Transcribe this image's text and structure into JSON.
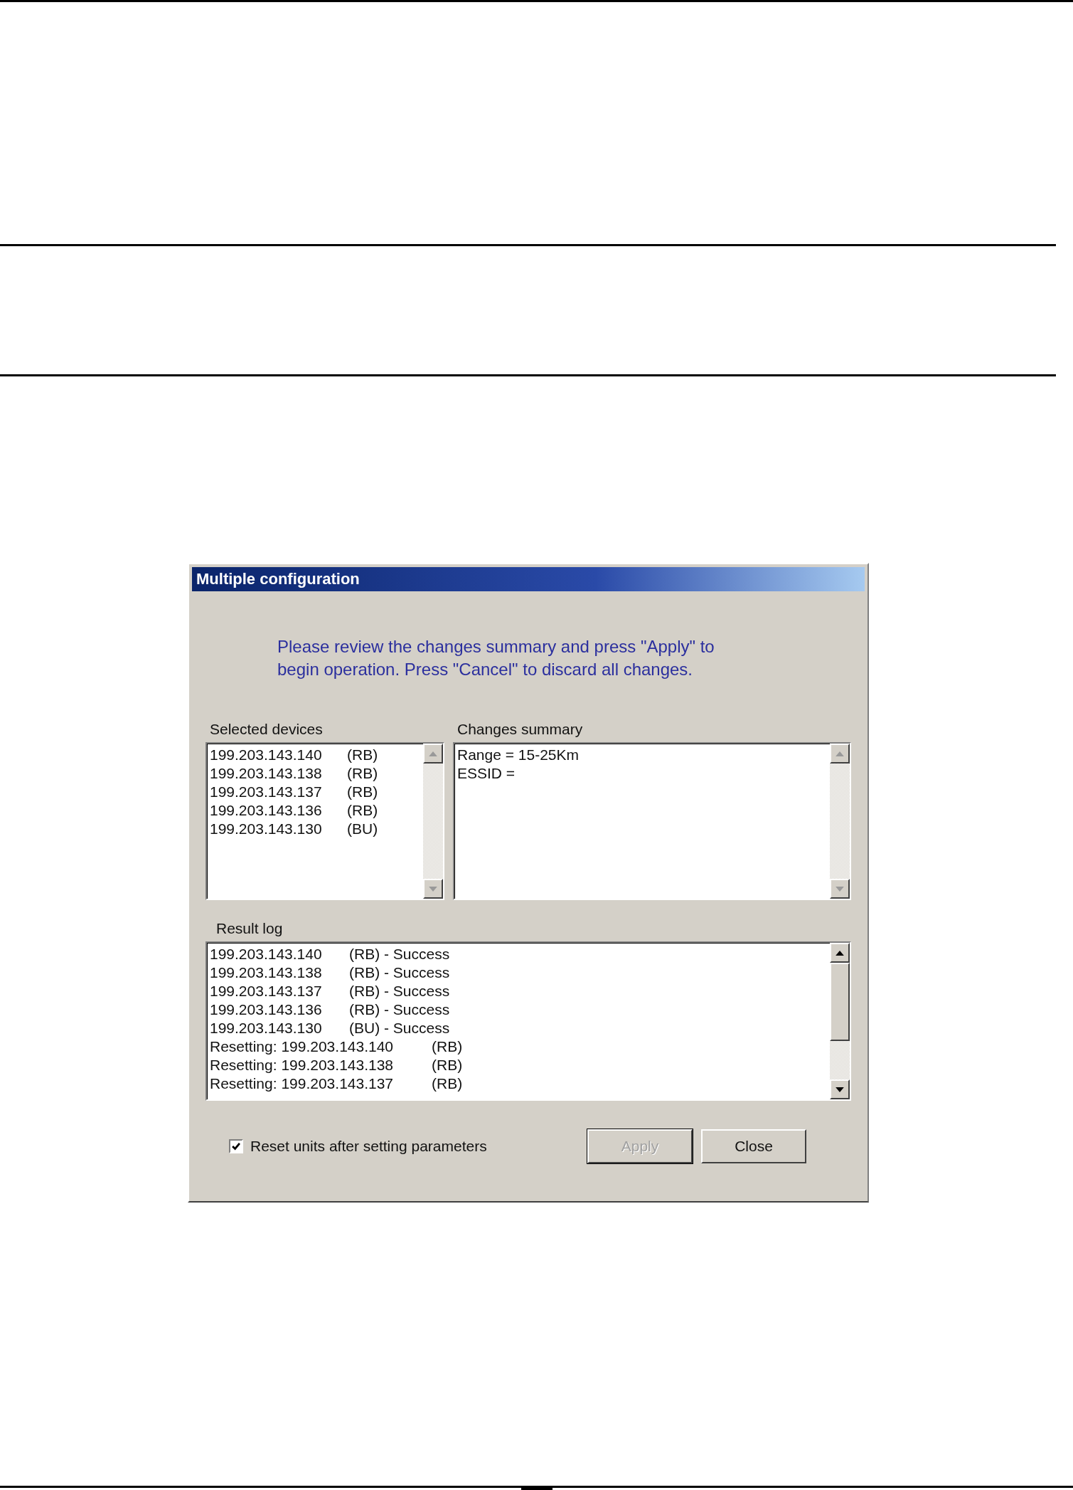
{
  "dialog": {
    "title": "Multiple configuration",
    "message": "Please review the changes summary and press \"Apply\" to begin operation.  Press \"Cancel\" to discard all changes.",
    "selected_devices": {
      "label": "Selected devices",
      "items": [
        {
          "text": "199.203.143.140",
          "tag": "(RB)"
        },
        {
          "text": "199.203.143.138",
          "tag": "(RB)"
        },
        {
          "text": "199.203.143.137",
          "tag": "(RB)"
        },
        {
          "text": "199.203.143.136",
          "tag": "(RB)"
        },
        {
          "text": "199.203.143.130",
          "tag": "(BU)"
        }
      ]
    },
    "changes_summary": {
      "label": "Changes summary",
      "lines": [
        "Range = 15-25Km",
        "ESSID ="
      ]
    },
    "result_log": {
      "label": "Result log",
      "items": [
        {
          "text": "199.203.143.140",
          "tag": "(RB) - Success"
        },
        {
          "text": "199.203.143.138",
          "tag": "(RB) - Success"
        },
        {
          "text": "199.203.143.137",
          "tag": "(RB) - Success"
        },
        {
          "text": "199.203.143.136",
          "tag": "(RB) - Success"
        },
        {
          "text": "199.203.143.130",
          "tag": "(BU) - Success"
        },
        {
          "text": "Resetting: 199.203.143.140",
          "tag": "(RB)"
        },
        {
          "text": "Resetting: 199.203.143.138",
          "tag": "(RB)"
        },
        {
          "text": "Resetting: 199.203.143.137",
          "tag": "(RB)"
        }
      ]
    },
    "reset_checkbox": {
      "label": "Reset units after setting parameters",
      "checked": true
    },
    "buttons": [
      {
        "label": "Apply",
        "disabled": true
      },
      {
        "label": "Close",
        "disabled": false
      }
    ]
  }
}
